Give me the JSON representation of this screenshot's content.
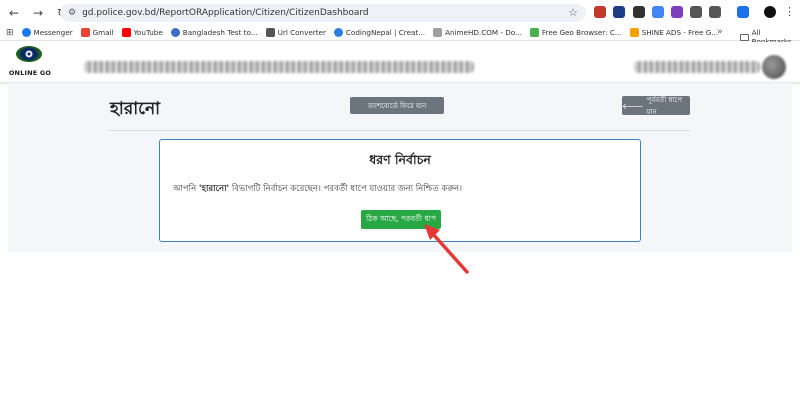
{
  "browser": {
    "url": "gd.police.gov.bd/ReportORApplication/Citizen/CitizenDashboard",
    "nav": {
      "back": "←",
      "forward": "→",
      "reload": "↻"
    },
    "extensions": [
      {
        "name": "ext-icon-1",
        "color": "#c0392b"
      },
      {
        "name": "ext-icon-2",
        "color": "#1f3c88"
      },
      {
        "name": "ext-icon-3",
        "color": "#333333"
      },
      {
        "name": "ext-icon-4",
        "color": "#4285f4"
      },
      {
        "name": "ext-icon-5",
        "color": "#7b3fbf"
      },
      {
        "name": "ext-icon-6",
        "color": "#555555"
      },
      {
        "name": "ext-icon-7",
        "color": "#555555"
      },
      {
        "name": "ext-icon-8",
        "color": "#1a73e8"
      }
    ]
  },
  "bookmarks": {
    "items": [
      {
        "label": "Messenger",
        "icon": "messenger-icon",
        "color": "#1877f2"
      },
      {
        "label": "Gmail",
        "icon": "gmail-icon",
        "color": "#ea4335"
      },
      {
        "label": "YouTube",
        "icon": "youtube-icon",
        "color": "#ff0000"
      },
      {
        "label": "Bangladesh Test to...",
        "icon": "globe-icon",
        "color": "#3d6bc5"
      },
      {
        "label": "Url Converter",
        "icon": "url-converter-icon",
        "color": "#555555"
      },
      {
        "label": "CodingNepal | Creat...",
        "icon": "codingnepal-icon",
        "color": "#2a7de1"
      },
      {
        "label": "AnimeHD.COM - Do...",
        "icon": "page-icon",
        "color": "#9e9e9e"
      },
      {
        "label": "Free Geo Browser: C...",
        "icon": "geo-browser-icon",
        "color": "#4caf50"
      },
      {
        "label": "SHINE ADS - Free G...",
        "icon": "shine-ads-icon",
        "color": "#f4a100"
      }
    ],
    "more": "»",
    "all_bookmarks": "All Bookmarks"
  },
  "site": {
    "logo_text": "ONLINE GO"
  },
  "page": {
    "title": "হারানো",
    "dashboard_button": "ড্যাশবোর্ডে ফিরে যান",
    "back_button": "পূর্ববর্তী ধাপে যান",
    "card": {
      "title": "ধরণ নির্বাচন",
      "text_before": "আপনি ",
      "selected_type": "'হারানো'",
      "text_after": " বিভাগটি নির্বাচন করেছেন। পরবর্তী ধাপে যাওয়ার জন্য নিশ্চিত করুন।",
      "confirm_button": "ঠিক আছে, পরবর্তী ধাপ"
    }
  },
  "colors": {
    "primary_secondary_button": "#6c757d",
    "confirm_button": "#28a745",
    "card_border": "#3b82c4",
    "annotation_arrow": "#e53935"
  }
}
